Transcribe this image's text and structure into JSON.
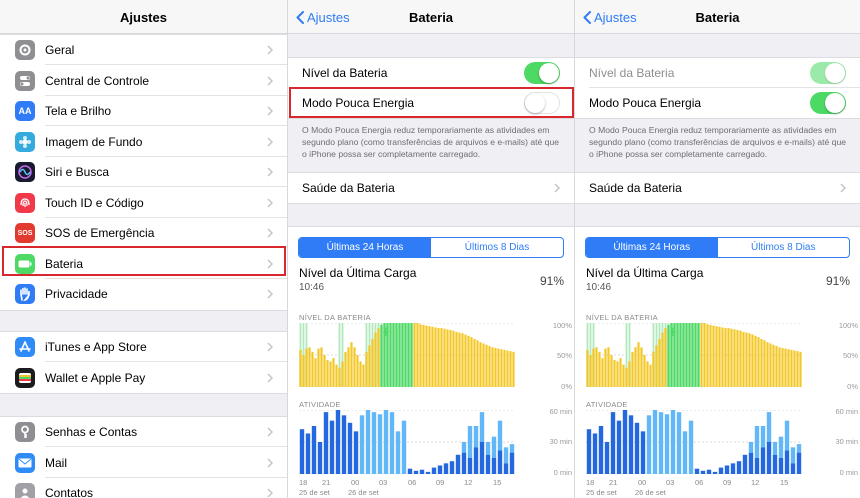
{
  "colors": {
    "accent": "#2f7cf6",
    "toggle_on": "#4cd964",
    "highlight": "#d9272e",
    "battery_bar": "#f3c826",
    "charging_fill": "#4cd964",
    "activity_dark": "#2468e0",
    "activity_light": "#62b7f7"
  },
  "settings": {
    "title": "Ajustes",
    "groups": [
      {
        "items": [
          {
            "label": "Geral",
            "icon": "gear-icon",
            "color": "#8e8e93"
          },
          {
            "label": "Central de Controle",
            "icon": "toggles-icon",
            "color": "#8e8e93"
          },
          {
            "label": "Tela e Brilho",
            "icon": "text-size-icon",
            "color": "#2f7cf6"
          },
          {
            "label": "Imagem de Fundo",
            "icon": "flower-icon",
            "color": "#35aadc"
          },
          {
            "label": "Siri e Busca",
            "icon": "siri-icon",
            "color": "#1a1a2e"
          },
          {
            "label": "Touch ID e Código",
            "icon": "fingerprint-icon",
            "color": "#f2394a"
          },
          {
            "label": "SOS de Emergência",
            "icon": "sos-icon",
            "color": "#e23a2f"
          },
          {
            "label": "Bateria",
            "icon": "battery-icon",
            "color": "#4cd964"
          },
          {
            "label": "Privacidade",
            "icon": "hand-icon",
            "color": "#2f7cf6"
          }
        ]
      },
      {
        "items": [
          {
            "label": "iTunes e App Store",
            "icon": "app-store-icon",
            "color": "#2f8cf6"
          },
          {
            "label": "Wallet e Apple Pay",
            "icon": "wallet-icon",
            "color": "#1c1c1e"
          }
        ]
      },
      {
        "items": [
          {
            "label": "Senhas e Contas",
            "icon": "key-icon",
            "color": "#8e8e93"
          },
          {
            "label": "Mail",
            "icon": "mail-icon",
            "color": "#2f8cf6"
          },
          {
            "label": "Contatos",
            "icon": "contacts-icon",
            "color": "#a0a0a6"
          }
        ]
      }
    ]
  },
  "battery": {
    "back_label": "Ajustes",
    "title": "Bateria",
    "battery_level_label": "Nível da Bateria",
    "low_power_label": "Modo Pouca Energia",
    "low_power_footnote": "O Modo Pouca Energia reduz temporariamente as atividades em segundo plano (como transferências de arquivos e e-mails) até que o iPhone possa ser completamente carregado.",
    "battery_health_label": "Saúde da Bateria",
    "tabs": [
      "Últimas 24 Horas",
      "Últimos 8 Dias"
    ],
    "last_charge_label": "Nível da Última Carga",
    "last_charge_time": "10:46",
    "last_charge_pct": "91%",
    "level_section": "NÍVEL DA BATERIA",
    "level_axis": [
      "100%",
      "50%",
      "0%"
    ],
    "activity_section": "ATIVIDADE",
    "activity_axis": [
      "60 min",
      "30 min",
      "0 min"
    ],
    "x_ticks": [
      "18",
      "21",
      "00",
      "03",
      "06",
      "09",
      "12",
      "15"
    ],
    "x_dates": [
      "25 de set",
      "26 de set"
    ]
  },
  "state_before": {
    "battery_level_on": true,
    "low_power_on": false
  },
  "state_after": {
    "battery_level_on": true,
    "low_power_on": true
  }
}
